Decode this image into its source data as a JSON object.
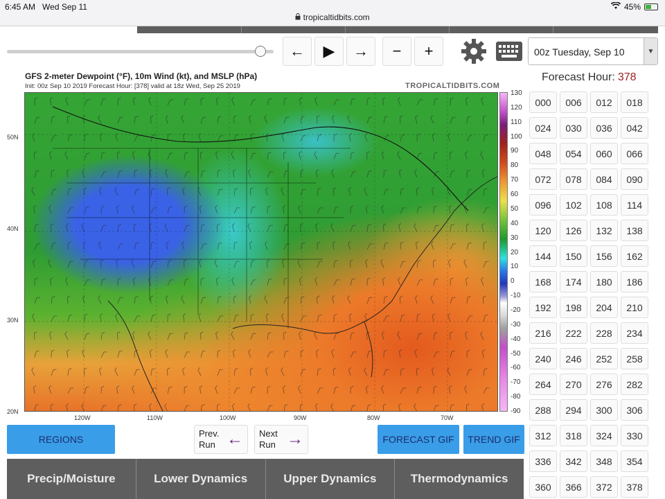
{
  "status": {
    "time": "6:45 AM",
    "date": "Wed Sep 11",
    "url": "tropicaltidbits.com",
    "battery": "45%",
    "battery_level": 0.45
  },
  "controls": {
    "slider_value": 0.95,
    "prev_symbol": "←",
    "play_symbol": "▶",
    "next_symbol": "→",
    "zoom_out_symbol": "−",
    "zoom_in_symbol": "+",
    "run_select": "00z Tuesday, Sep 10"
  },
  "map": {
    "title": "GFS 2-meter Dewpoint (°F), 10m Wind (kt), and MSLP (hPa)",
    "subtitle": "Init: 00z Sep 10 2019   Forecast Hour: [378]   valid at 18z Wed, Sep 25 2019",
    "logo": "TROPICALTIDBITS.COM",
    "lat_labels": [
      "50N",
      "40N",
      "30N",
      "20N"
    ],
    "lon_labels": [
      "120W",
      "110W",
      "100W",
      "90W",
      "80W",
      "70W"
    ],
    "colorbar_labels": [
      "130",
      "120",
      "110",
      "100",
      "90",
      "80",
      "70",
      "60",
      "50",
      "40",
      "30",
      "20",
      "10",
      "0",
      "-10",
      "-20",
      "-30",
      "-40",
      "-50",
      "-60",
      "-70",
      "-80",
      "-90"
    ]
  },
  "forecast": {
    "label": "Forecast Hour:",
    "current": "378",
    "hours": [
      "000",
      "006",
      "012",
      "018",
      "024",
      "030",
      "036",
      "042",
      "048",
      "054",
      "060",
      "066",
      "072",
      "078",
      "084",
      "090",
      "096",
      "102",
      "108",
      "114",
      "120",
      "126",
      "132",
      "138",
      "144",
      "150",
      "156",
      "162",
      "168",
      "174",
      "180",
      "186",
      "192",
      "198",
      "204",
      "210",
      "216",
      "222",
      "228",
      "234",
      "240",
      "246",
      "252",
      "258",
      "264",
      "270",
      "276",
      "282",
      "288",
      "294",
      "300",
      "306",
      "312",
      "318",
      "324",
      "330",
      "336",
      "342",
      "348",
      "354",
      "360",
      "366",
      "372",
      "378"
    ]
  },
  "buttons": {
    "regions": "REGIONS",
    "prev_run_1": "Prev.",
    "prev_run_2": "Run",
    "next_run_1": "Next",
    "next_run_2": "Run",
    "forecast_gif": "FORECAST GIF",
    "trend_gif": "TREND GIF"
  },
  "tabs": [
    "Precip/Moisture",
    "Lower Dynamics",
    "Upper Dynamics",
    "Thermodynamics"
  ]
}
